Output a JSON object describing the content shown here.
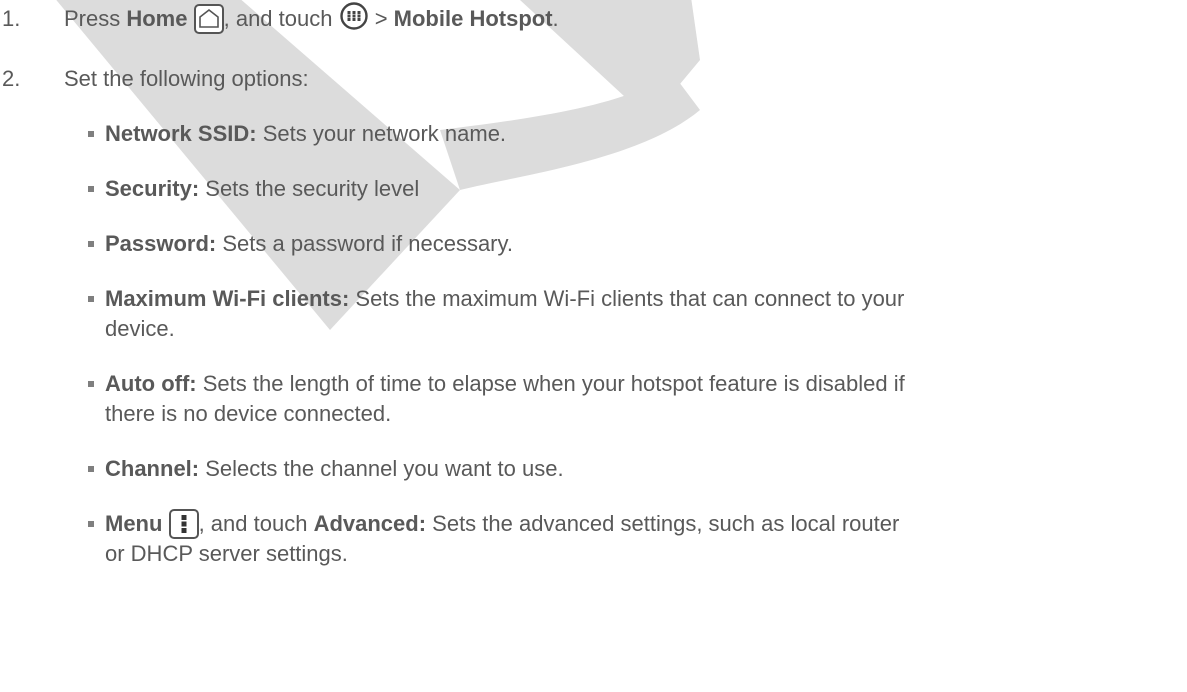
{
  "steps": [
    {
      "number": "1.",
      "prefix": "Press ",
      "home_label": "Home",
      "mid_text": ", and touch ",
      "sep_text": " > ",
      "hotspot_label": "Mobile Hotspot",
      "end_text": "."
    },
    {
      "number": "2.",
      "text": "Set the following options:"
    }
  ],
  "options": [
    {
      "label": "Network SSID:",
      "desc": " Sets your network name."
    },
    {
      "label": "Security:",
      "desc": " Sets the security level"
    },
    {
      "label": "Password:",
      "desc": " Sets a password if necessary."
    },
    {
      "label": "Maximum Wi-Fi clients:",
      "desc": " Sets the maximum Wi-Fi clients that can connect to your",
      "desc2": "device."
    },
    {
      "label": "Auto off:",
      "desc": " Sets the length of time to elapse when your hotspot feature is disabled if",
      "desc2": "there is no device connected."
    },
    {
      "label": "Channel:",
      "desc": " Selects the channel you want to use."
    }
  ],
  "menu_option": {
    "label": "Menu",
    "mid_text": ", and touch ",
    "advanced_label": "Advanced:",
    "desc": " Sets the advanced settings, such as local router",
    "desc2": "or DHCP server settings."
  },
  "icons": {
    "home": "home-icon",
    "apps": "apps-icon",
    "menu": "menu-icon"
  },
  "colors": {
    "text": "#595959",
    "watermark": "#d9d9d9"
  }
}
